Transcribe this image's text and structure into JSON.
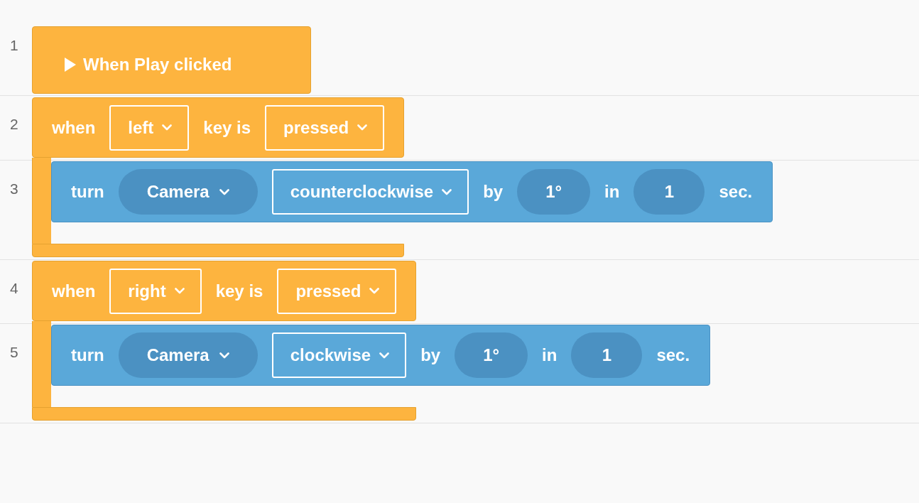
{
  "line_numbers": [
    "1",
    "2",
    "3",
    "4",
    "5"
  ],
  "hat": {
    "label": "When Play clicked"
  },
  "events": [
    {
      "parts": [
        {
          "kind": "text",
          "text": "when"
        },
        {
          "kind": "dropdown",
          "text": "left"
        },
        {
          "kind": "text",
          "text": "key is"
        },
        {
          "kind": "dropdown",
          "text": "pressed"
        }
      ],
      "actions": [
        {
          "parts": [
            {
              "kind": "text",
              "text": "turn"
            },
            {
              "kind": "pill-dropdown",
              "text": "Camera"
            },
            {
              "kind": "dropdown",
              "text": "counterclockwise"
            },
            {
              "kind": "text",
              "text": "by"
            },
            {
              "kind": "pill",
              "text": "1°"
            },
            {
              "kind": "text",
              "text": "in"
            },
            {
              "kind": "pill",
              "text": "1"
            },
            {
              "kind": "text",
              "text": "sec."
            }
          ]
        }
      ]
    },
    {
      "parts": [
        {
          "kind": "text",
          "text": "when"
        },
        {
          "kind": "dropdown",
          "text": "right"
        },
        {
          "kind": "text",
          "text": "key is"
        },
        {
          "kind": "dropdown",
          "text": "pressed"
        }
      ],
      "actions": [
        {
          "parts": [
            {
              "kind": "text",
              "text": "turn"
            },
            {
              "kind": "pill-dropdown",
              "text": "Camera"
            },
            {
              "kind": "dropdown",
              "text": "clockwise"
            },
            {
              "kind": "text",
              "text": "by"
            },
            {
              "kind": "pill",
              "text": "1°"
            },
            {
              "kind": "text",
              "text": "in"
            },
            {
              "kind": "pill",
              "text": "1"
            },
            {
              "kind": "text",
              "text": "sec."
            }
          ]
        }
      ]
    }
  ]
}
